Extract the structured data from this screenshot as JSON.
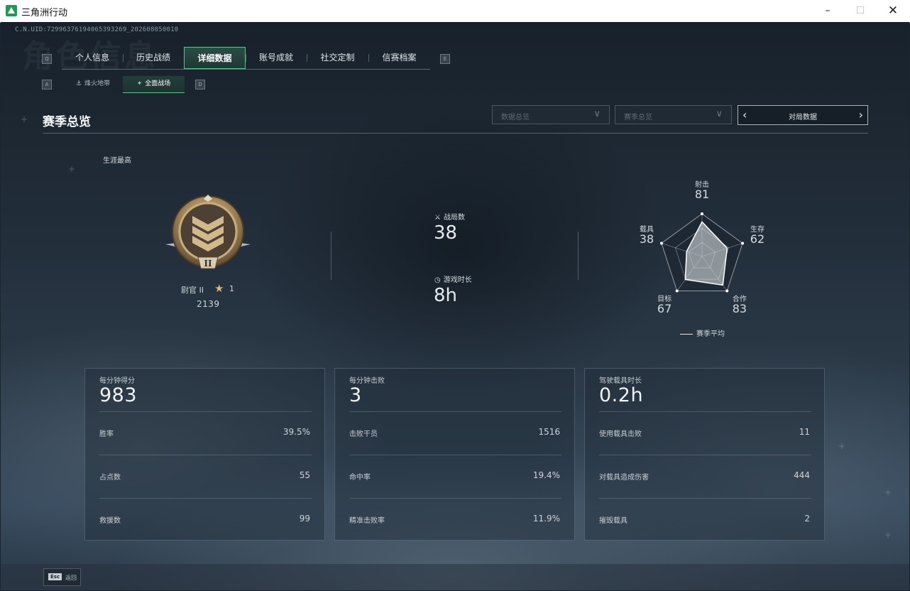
{
  "window": {
    "title": "三角洲行动",
    "minimize_icon": "minimize-icon",
    "maximize_icon": "maximize-icon",
    "close_icon": "close-icon"
  },
  "header": {
    "uid": "C.N.UID:72996376194065393269_202608050010",
    "ghost_title": "角色信息"
  },
  "primary_tabs": {
    "left_key": "Q",
    "right_key": "E",
    "items": [
      {
        "label": "个人信息"
      },
      {
        "label": "历史战绩"
      },
      {
        "label": "详细数据",
        "active": true
      },
      {
        "label": "账号成就"
      },
      {
        "label": "社交定制"
      },
      {
        "label": "信赛档案"
      }
    ]
  },
  "secondary_tabs": {
    "left_key": "A",
    "right_key": "D",
    "items": [
      {
        "label": "烽火地带",
        "icon": "anchor-icon"
      },
      {
        "label": "全面战场",
        "icon": "wing-icon",
        "active": true
      }
    ]
  },
  "section": {
    "title": "赛季总览",
    "dropdown_data": "数据总览",
    "dropdown_season": "赛季总览",
    "pager_label": "对局数据"
  },
  "career": {
    "label": "生涯最高",
    "rank_name": "尉官 II",
    "rank_stars": "1",
    "rank_score": "2139",
    "badge_numeral": "II"
  },
  "summary": {
    "matches_label": "战局数",
    "matches_value": "38",
    "playtime_label": "游戏时长",
    "playtime_value": "8h"
  },
  "radar": {
    "axes": [
      {
        "label": "射击",
        "value": 81
      },
      {
        "label": "生存",
        "value": 62
      },
      {
        "label": "合作",
        "value": 83
      },
      {
        "label": "目标",
        "value": 67
      },
      {
        "label": "载具",
        "value": 38
      }
    ],
    "legend": "赛季平均",
    "colors": {
      "fill": "#d9dde0",
      "line": "#ffffff",
      "grid": "#c4cbd0"
    }
  },
  "cards": [
    {
      "head_label": "每分钟得分",
      "head_value": "983",
      "rows": [
        {
          "label": "胜率",
          "value": "39.5%"
        },
        {
          "label": "占点数",
          "value": "55"
        },
        {
          "label": "救援数",
          "value": "99"
        }
      ]
    },
    {
      "head_label": "每分钟击败",
      "head_value": "3",
      "rows": [
        {
          "label": "击败干员",
          "value": "1516"
        },
        {
          "label": "命中率",
          "value": "19.4%"
        },
        {
          "label": "精准击败率",
          "value": "11.9%"
        }
      ]
    },
    {
      "head_label": "驾驶载具时长",
      "head_value": "0.2h",
      "rows": [
        {
          "label": "使用载具击败",
          "value": "11"
        },
        {
          "label": "对载具造成伤害",
          "value": "444"
        },
        {
          "label": "摧毁载具",
          "value": "2"
        }
      ]
    }
  ],
  "footer": {
    "esc_key": "Esc",
    "esc_label": "返回"
  },
  "colors": {
    "accent": "#5fbf8f",
    "background": "#1b2530"
  }
}
